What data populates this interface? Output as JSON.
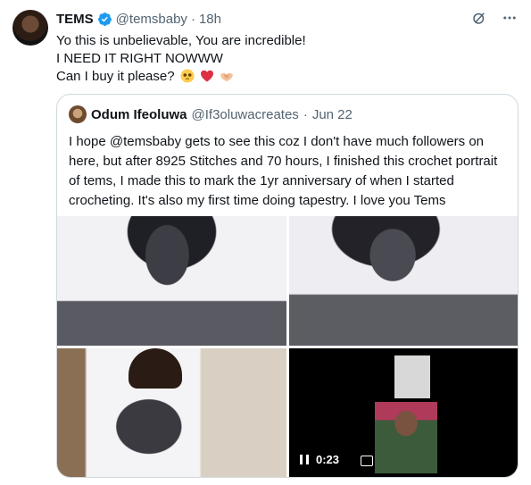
{
  "tweet": {
    "author_name": "TEMS",
    "author_handle": "@temsbaby",
    "separator": "·",
    "time": "18h",
    "lines": [
      "Yo this is unbelievable, You are incredible!",
      "I NEED IT RIGHT NOWWW",
      "Can I buy it please?"
    ],
    "emojis": [
      "pleading-face",
      "red-heart",
      "hand-heart"
    ]
  },
  "quote": {
    "author_name": "Odum Ifeoluwa",
    "author_handle": "@If3oluwacreates",
    "separator": "·",
    "date": "Jun 22",
    "text": "I hope @temsbaby gets to see this coz I don't have much followers on here, but after 8925 Stitches and 70 hours, I finished this crochet portrait of tems, I made this to mark the 1yr anniversary of when I started crocheting. It's also my first time doing tapestry. I love you Tems",
    "video_time": "0:23"
  },
  "colors": {
    "verified": "#1d9bf0",
    "muted": "#536471",
    "border": "#cfd9de"
  }
}
